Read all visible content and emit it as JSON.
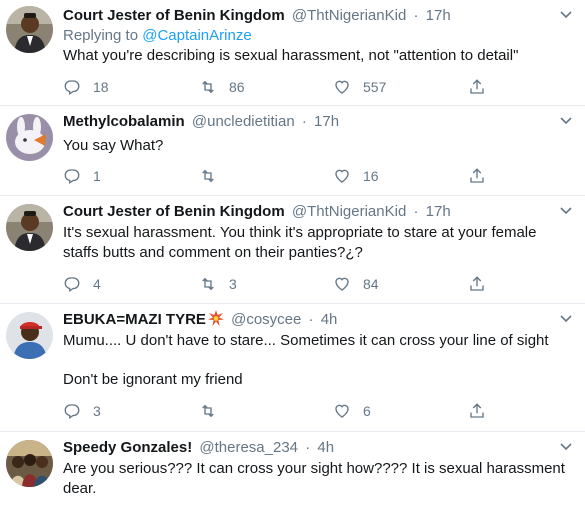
{
  "tweets": [
    {
      "name": "Court Jester of Benin Kingdom",
      "handle": "@ThtNigerianKid",
      "time": "17h",
      "replying_label": "Replying to",
      "replying_to": "@CaptainArinze",
      "text": "What you're describing is sexual harassment, not \"attention to detail\"",
      "replies": "18",
      "retweets": "86",
      "likes": "557",
      "avatar_icon": "avatar-man-suit"
    },
    {
      "name": "Methylcobalamin",
      "handle": "@uncledietitian",
      "time": "17h",
      "text": "You say What?",
      "replies": "1",
      "retweets": "",
      "likes": "16",
      "avatar_icon": "avatar-bunny"
    },
    {
      "name": "Court Jester of Benin Kingdom",
      "handle": "@ThtNigerianKid",
      "time": "17h",
      "text": "It's sexual harassment. You think it's appropriate to stare at your female staffs butts and comment on their panties?¿?",
      "replies": "4",
      "retweets": "3",
      "likes": "84",
      "avatar_icon": "avatar-man-suit"
    },
    {
      "name": "EBUKA=MAZI TYRE",
      "name_emoji": "collision-emoji",
      "handle": "@cosycee",
      "time": "4h",
      "text": "Mumu.... U don't have to stare... Sometimes it can cross your line of sight\n\nDon't be ignorant my friend",
      "replies": "3",
      "retweets": "",
      "likes": "6",
      "avatar_icon": "avatar-man-red-cap"
    },
    {
      "name": "Speedy Gonzales!",
      "handle": "@theresa_234",
      "time": "4h",
      "text": "Are you serious??? It can cross your sight how???? It is sexual harassment dear.",
      "avatar_icon": "avatar-group-photo"
    }
  ],
  "separator": "·",
  "icons": {
    "reply": "reply-icon",
    "retweet": "retweet-icon",
    "like": "heart-icon",
    "share": "share-icon",
    "more": "chevron-down-icon"
  },
  "colors": {
    "text": "#14171a",
    "muted": "#657786",
    "link": "#1da1f2",
    "divider": "#e6ecf0",
    "emoji": "#e0502b"
  }
}
